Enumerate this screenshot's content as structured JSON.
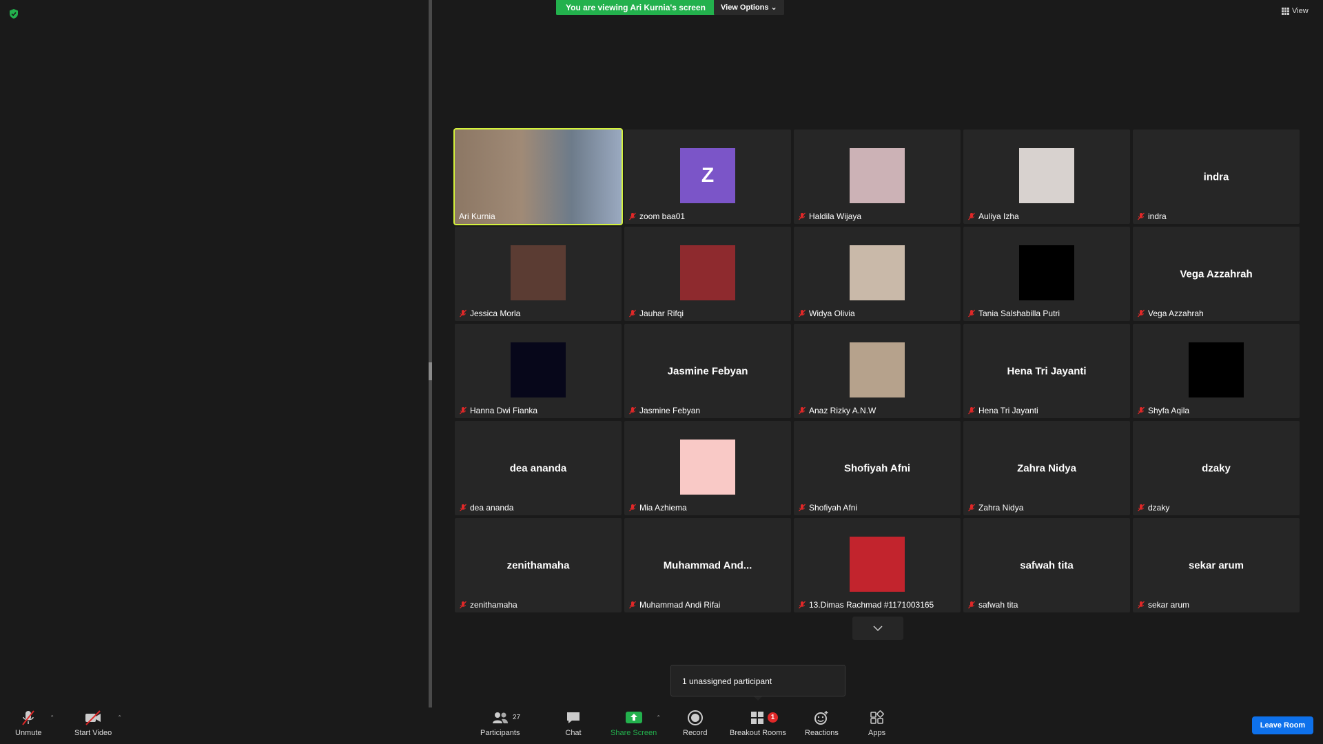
{
  "share_banner": "You are viewing Ari Kurnia's screen",
  "view_options": "View Options",
  "view_button": "View",
  "participants": [
    {
      "label": "Ari Kurnia",
      "type": "video"
    },
    {
      "label": "zoom baa01",
      "type": "avatar-letter",
      "letter": "Z",
      "color": "#7b55c8"
    },
    {
      "label": "Haldila Wijaya",
      "type": "photo",
      "color": "#ccb2b6"
    },
    {
      "label": "Auliya Izha",
      "type": "photo",
      "color": "#d8d2cf"
    },
    {
      "label": "indra",
      "type": "name",
      "big": "indra"
    },
    {
      "label": "Jessica Morla",
      "type": "photo",
      "color": "#5b3c33"
    },
    {
      "label": "Jauhar Rifqi",
      "type": "photo",
      "color": "#8e2a2e"
    },
    {
      "label": "Widya Olivia",
      "type": "photo",
      "color": "#c9b9a9"
    },
    {
      "label": "Tania Salshabilla Putri",
      "type": "photo",
      "color": "#000000"
    },
    {
      "label": "Vega Azzahrah",
      "type": "name",
      "big": "Vega Azzahrah"
    },
    {
      "label": "Hanna Dwi Fianka",
      "type": "photo",
      "color": "#07071a"
    },
    {
      "label": "Jasmine Febyan",
      "type": "name",
      "big": "Jasmine Febyan"
    },
    {
      "label": "Anaz Rizky A.N.W",
      "type": "photo",
      "color": "#b6a28c"
    },
    {
      "label": "Hena Tri Jayanti",
      "type": "name",
      "big": "Hena Tri Jayanti"
    },
    {
      "label": "Shyfa Aqila",
      "type": "photo",
      "color": "#000000"
    },
    {
      "label": "dea ananda",
      "type": "name",
      "big": "dea ananda"
    },
    {
      "label": "Mia Azhiema",
      "type": "photo",
      "color": "#f9c9c6"
    },
    {
      "label": "Shofiyah Afni",
      "type": "name",
      "big": "Shofiyah Afni"
    },
    {
      "label": "Zahra Nidya",
      "type": "name",
      "big": "Zahra Nidya"
    },
    {
      "label": "dzaky",
      "type": "name",
      "big": "dzaky"
    },
    {
      "label": "zenithamaha",
      "type": "name",
      "big": "zenithamaha"
    },
    {
      "label": "Muhammad Andi Rifai",
      "type": "name",
      "big": "Muhammad  And..."
    },
    {
      "label": "13.Dimas Rachmad #1171003165",
      "type": "photo",
      "color": "#c2242d"
    },
    {
      "label": "safwah tita",
      "type": "name",
      "big": "safwah tita"
    },
    {
      "label": "sekar arum",
      "type": "name",
      "big": "sekar arum"
    }
  ],
  "tooltip": "1 unassigned participant",
  "toolbar": {
    "unmute": "Unmute",
    "start_video": "Start Video",
    "participants": "Participants",
    "participants_count": "27",
    "chat": "Chat",
    "share_screen": "Share Screen",
    "record": "Record",
    "breakout_rooms": "Breakout Rooms",
    "breakout_badge": "1",
    "reactions": "Reactions",
    "apps": "Apps",
    "leave_room": "Leave Room"
  }
}
